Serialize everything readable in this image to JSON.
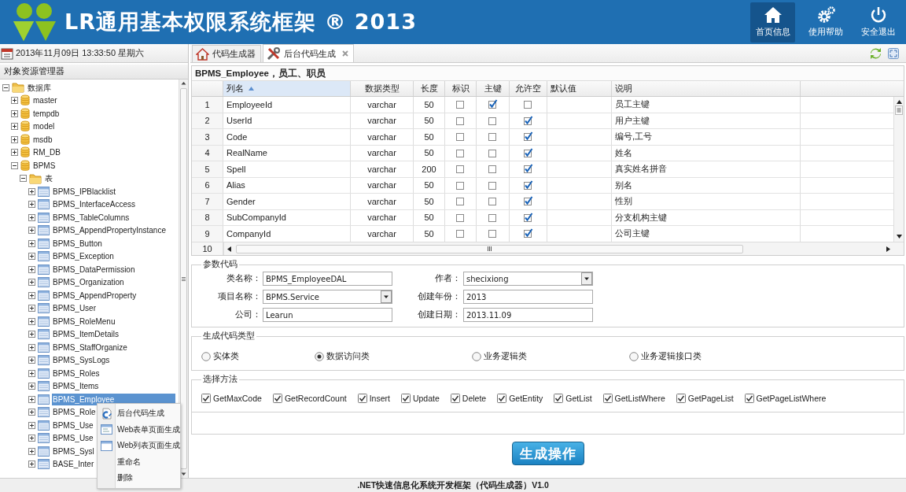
{
  "header": {
    "title": "LR通用基本权限系统框架 ® 2013",
    "nav": [
      {
        "label": "首页信息",
        "kind": "home",
        "selected": true
      },
      {
        "label": "使用帮助",
        "kind": "gear",
        "selected": false
      },
      {
        "label": "安全退出",
        "kind": "power",
        "selected": false
      }
    ]
  },
  "sidebar": {
    "datetime": "2013年11月09日 13:33:50 星期六",
    "title": "对象资源管理器",
    "tree": [
      {
        "label": "数据库",
        "kind": "folder",
        "expanded": true,
        "selected": false,
        "children": [
          {
            "label": "master",
            "kind": "database",
            "expanded": false,
            "selected": false
          },
          {
            "label": "tempdb",
            "kind": "database",
            "expanded": false,
            "selected": false
          },
          {
            "label": "model",
            "kind": "database",
            "expanded": false,
            "selected": false
          },
          {
            "label": "msdb",
            "kind": "database",
            "expanded": false,
            "selected": false
          },
          {
            "label": "RM_DB",
            "kind": "database",
            "expanded": false,
            "selected": false
          },
          {
            "label": "BPMS",
            "kind": "database",
            "expanded": true,
            "selected": false,
            "children": [
              {
                "label": "表",
                "kind": "folder",
                "expanded": true,
                "selected": false,
                "children": [
                  {
                    "label": "BPMS_IPBlacklist",
                    "kind": "table",
                    "expanded": false,
                    "selected": false
                  },
                  {
                    "label": "BPMS_InterfaceAccess",
                    "kind": "table",
                    "expanded": false,
                    "selected": false
                  },
                  {
                    "label": "BPMS_TableColumns",
                    "kind": "table",
                    "expanded": false,
                    "selected": false
                  },
                  {
                    "label": "BPMS_AppendPropertyInstance",
                    "kind": "table",
                    "expanded": false,
                    "selected": false
                  },
                  {
                    "label": "BPMS_Button",
                    "kind": "table",
                    "expanded": false,
                    "selected": false
                  },
                  {
                    "label": "BPMS_Exception",
                    "kind": "table",
                    "expanded": false,
                    "selected": false
                  },
                  {
                    "label": "BPMS_DataPermission",
                    "kind": "table",
                    "expanded": false,
                    "selected": false
                  },
                  {
                    "label": "BPMS_Organization",
                    "kind": "table",
                    "expanded": false,
                    "selected": false
                  },
                  {
                    "label": "BPMS_AppendProperty",
                    "kind": "table",
                    "expanded": false,
                    "selected": false
                  },
                  {
                    "label": "BPMS_User",
                    "kind": "table",
                    "expanded": false,
                    "selected": false
                  },
                  {
                    "label": "BPMS_RoleMenu",
                    "kind": "table",
                    "expanded": false,
                    "selected": false
                  },
                  {
                    "label": "BPMS_ItemDetails",
                    "kind": "table",
                    "expanded": false,
                    "selected": false
                  },
                  {
                    "label": "BPMS_StaffOrganize",
                    "kind": "table",
                    "expanded": false,
                    "selected": false
                  },
                  {
                    "label": "BPMS_SysLogs",
                    "kind": "table",
                    "expanded": false,
                    "selected": false
                  },
                  {
                    "label": "BPMS_Roles",
                    "kind": "table",
                    "expanded": false,
                    "selected": false
                  },
                  {
                    "label": "BPMS_Items",
                    "kind": "table",
                    "expanded": false,
                    "selected": false
                  },
                  {
                    "label": "BPMS_Employee",
                    "kind": "table",
                    "expanded": false,
                    "selected": true
                  },
                  {
                    "label": "BPMS_Role",
                    "kind": "table",
                    "expanded": false,
                    "selected": false
                  },
                  {
                    "label": "BPMS_Use",
                    "kind": "table",
                    "expanded": false,
                    "selected": false
                  },
                  {
                    "label": "BPMS_Use",
                    "kind": "table",
                    "expanded": false,
                    "selected": false
                  },
                  {
                    "label": "BPMS_Sysl",
                    "kind": "table",
                    "expanded": false,
                    "selected": false
                  },
                  {
                    "label": "BASE_Inter",
                    "kind": "table",
                    "expanded": false,
                    "selected": false
                  }
                ]
              }
            ]
          }
        ]
      }
    ],
    "context_menu": [
      {
        "label": "后台代码生成",
        "kind": "code"
      },
      {
        "label": "Web表单页面生成",
        "kind": "form"
      },
      {
        "label": "Web列表页面生成",
        "kind": "list"
      },
      {
        "label": "重命名",
        "kind": "none"
      },
      {
        "label": "删除",
        "kind": "none"
      }
    ]
  },
  "tabs": [
    {
      "label": "代码生成器",
      "kind": "home",
      "closable": false,
      "selected": false
    },
    {
      "label": "后台代码生成",
      "kind": "tools",
      "closable": true,
      "selected": true
    }
  ],
  "table": {
    "title": "BPMS_Employee，员工、职员",
    "columns": [
      {
        "label": "列名",
        "sorted": true
      },
      {
        "label": "数据类型",
        "sorted": false
      },
      {
        "label": "长度",
        "sorted": false
      },
      {
        "label": "标识",
        "sorted": false
      },
      {
        "label": "主键",
        "sorted": false
      },
      {
        "label": "允许空",
        "sorted": false
      },
      {
        "label": "默认值",
        "sorted": false
      },
      {
        "label": "说明",
        "sorted": false
      }
    ],
    "rows": [
      {
        "number": "1",
        "name": "EmployeeId",
        "type": "varchar",
        "length": "50",
        "identity": false,
        "primary_key": true,
        "nullable": false,
        "description": "员工主键"
      },
      {
        "number": "2",
        "name": "UserId",
        "type": "varchar",
        "length": "50",
        "identity": false,
        "primary_key": false,
        "nullable": true,
        "description": "用户主键"
      },
      {
        "number": "3",
        "name": "Code",
        "type": "varchar",
        "length": "50",
        "identity": false,
        "primary_key": false,
        "nullable": true,
        "description": "编号,工号"
      },
      {
        "number": "4",
        "name": "RealName",
        "type": "varchar",
        "length": "50",
        "identity": false,
        "primary_key": false,
        "nullable": true,
        "description": "姓名"
      },
      {
        "number": "5",
        "name": "Spell",
        "type": "varchar",
        "length": "200",
        "identity": false,
        "primary_key": false,
        "nullable": true,
        "description": "真实姓名拼音"
      },
      {
        "number": "6",
        "name": "Alias",
        "type": "varchar",
        "length": "50",
        "identity": false,
        "primary_key": false,
        "nullable": true,
        "description": "别名"
      },
      {
        "number": "7",
        "name": "Gender",
        "type": "varchar",
        "length": "50",
        "identity": false,
        "primary_key": false,
        "nullable": true,
        "description": "性别"
      },
      {
        "number": "8",
        "name": "SubCompanyId",
        "type": "varchar",
        "length": "50",
        "identity": false,
        "primary_key": false,
        "nullable": true,
        "description": "分支机构主键"
      },
      {
        "number": "9",
        "name": "CompanyId",
        "type": "varchar",
        "length": "50",
        "identity": false,
        "primary_key": false,
        "nullable": true,
        "description": "公司主键"
      }
    ],
    "cut_row": {
      "number": "10"
    }
  },
  "params": {
    "title": "参数代码",
    "fields": [
      {
        "label": "类名称：",
        "value": "BPMS_EmployeeDAL",
        "kind": "text"
      },
      {
        "label": "作者：",
        "value": "shecixiong",
        "kind": "select"
      },
      {
        "label": "项目名称：",
        "value": "BPMS.Service",
        "kind": "select"
      },
      {
        "label": "创建年份：",
        "value": "2013",
        "kind": "text"
      },
      {
        "label": "公司：",
        "value": "Learun",
        "kind": "text"
      },
      {
        "label": "创建日期：",
        "value": "2013.11.09",
        "kind": "text"
      }
    ]
  },
  "code_type": {
    "title": "生成代码类型",
    "options": [
      {
        "label": "实体类",
        "selected": false
      },
      {
        "label": "数据访问类",
        "selected": true
      },
      {
        "label": "业务逻辑类",
        "selected": false
      },
      {
        "label": "业务逻辑接口类",
        "selected": false
      }
    ]
  },
  "methods": {
    "title": "选择方法",
    "items": [
      {
        "label": "GetMaxCode",
        "checked": true
      },
      {
        "label": "GetRecordCount",
        "checked": true
      },
      {
        "label": "Insert",
        "checked": true
      },
      {
        "label": "Update",
        "checked": true
      },
      {
        "label": "Delete",
        "checked": true
      },
      {
        "label": "GetEntity",
        "checked": true
      },
      {
        "label": "GetList",
        "checked": true
      },
      {
        "label": "GetListWhere",
        "checked": true
      },
      {
        "label": "GetPageList",
        "checked": true
      },
      {
        "label": "GetPageListWhere",
        "checked": true
      }
    ]
  },
  "generate_button": "生成操作",
  "footer": ".NET快速信息化系统开发框架（代码生成器）V1.0"
}
